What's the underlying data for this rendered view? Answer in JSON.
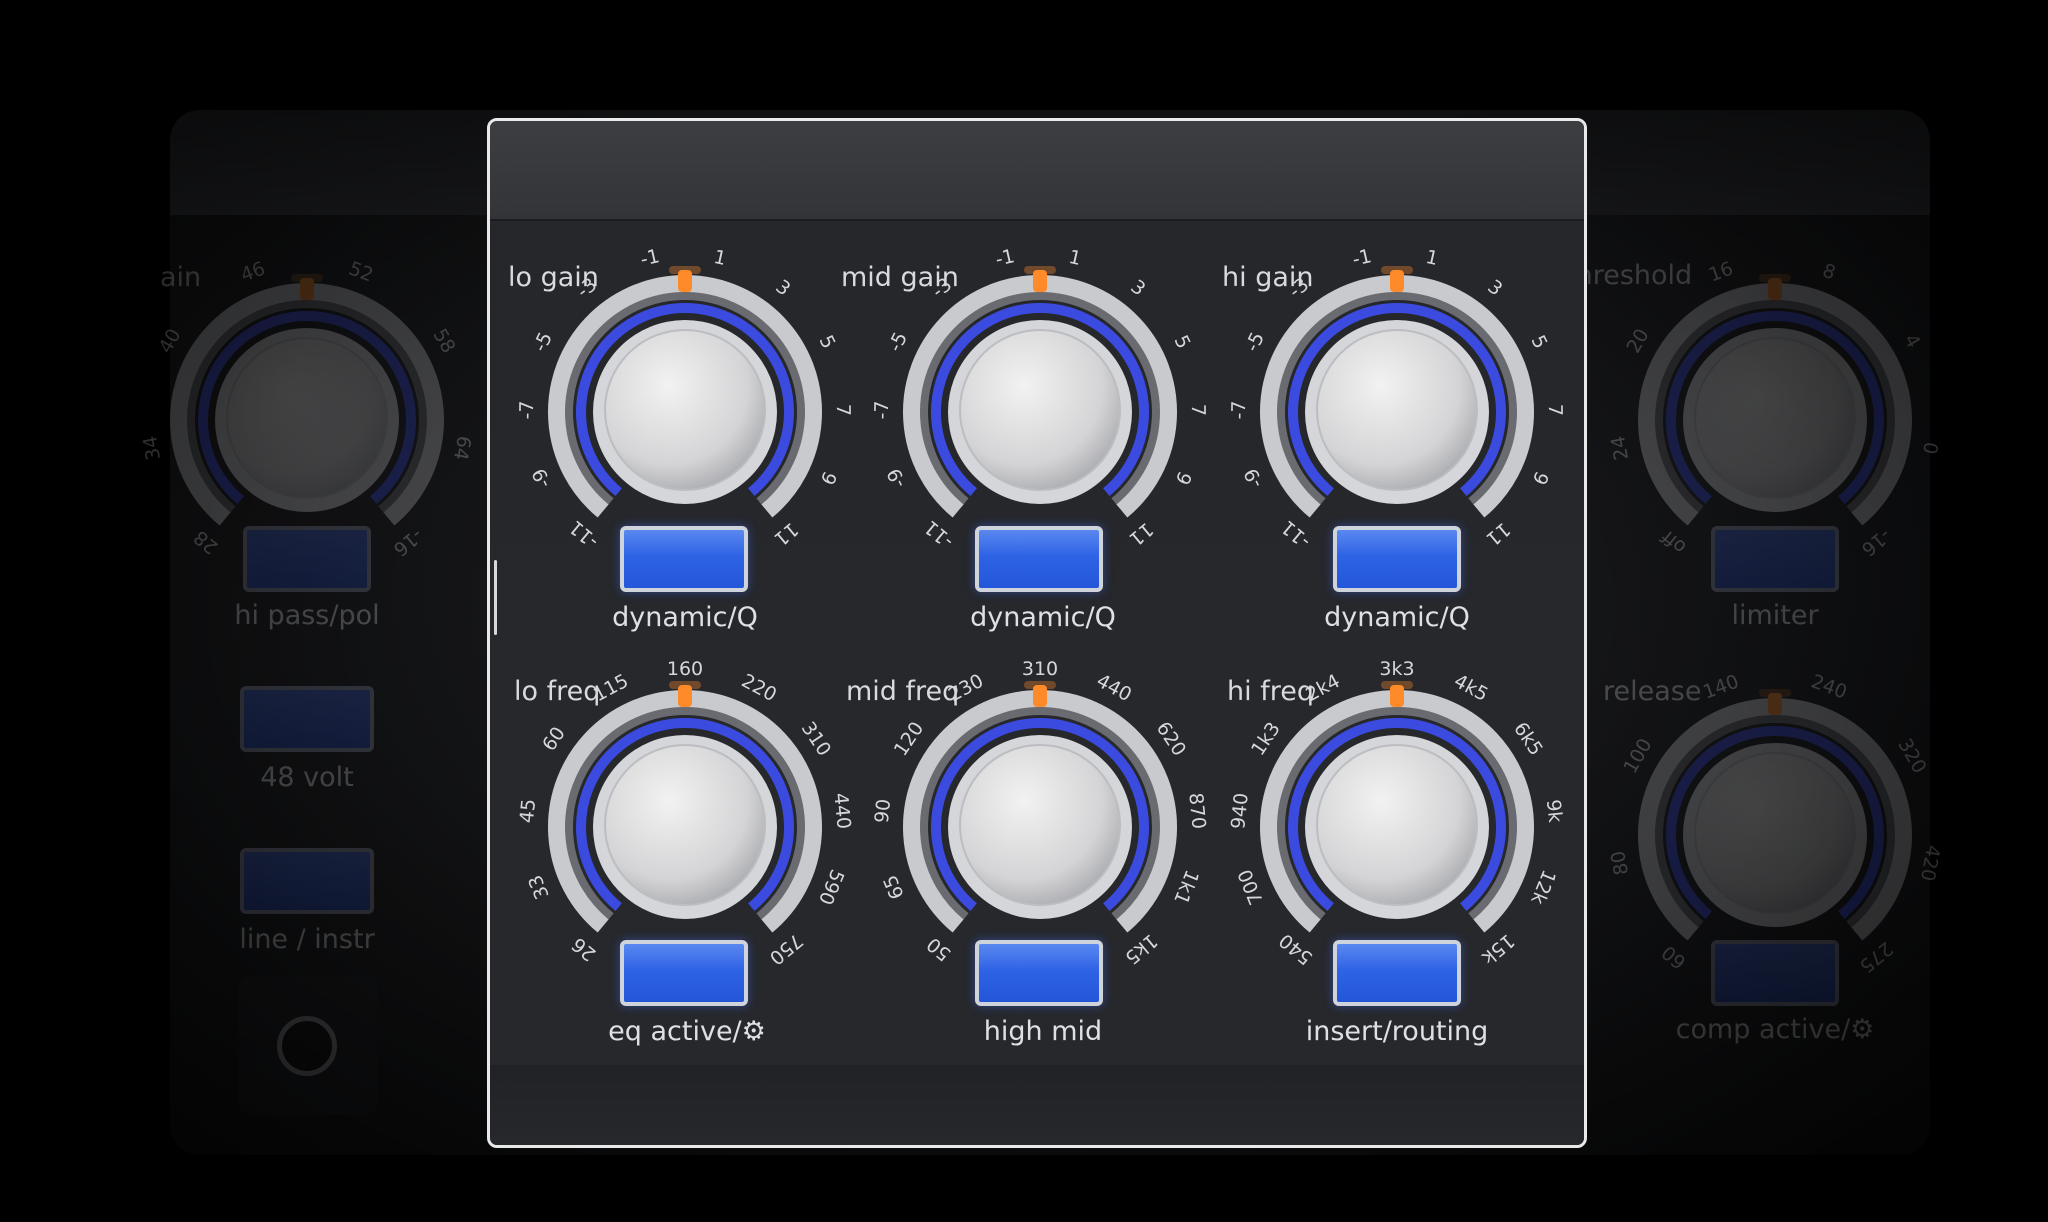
{
  "left_strip": {
    "gain": {
      "label": "ain",
      "ticks": [
        "28",
        "34",
        "40",
        "46",
        "52",
        "58",
        "64",
        "-16"
      ],
      "button_label": "hi pass/pol"
    },
    "phantom_button_label": "48 volt",
    "line_button_label": "line / instr"
  },
  "eq_panel": {
    "lo_gain": {
      "label": "lo gain",
      "ticks": [
        "-11",
        "-9",
        "-7",
        "-5",
        "-3",
        "-1",
        "1",
        "3",
        "5",
        "7",
        "9",
        "11"
      ],
      "button_label": "dynamic/Q"
    },
    "mid_gain": {
      "label": "mid gain",
      "ticks": [
        "-11",
        "-9",
        "-7",
        "-5",
        "-3",
        "-1",
        "1",
        "3",
        "5",
        "7",
        "9",
        "11"
      ],
      "button_label": "dynamic/Q"
    },
    "hi_gain": {
      "label": "hi gain",
      "ticks": [
        "-11",
        "-9",
        "-7",
        "-5",
        "-3",
        "-1",
        "1",
        "3",
        "5",
        "7",
        "9",
        "11"
      ],
      "button_label": "dynamic/Q"
    },
    "lo_freq": {
      "label": "lo freq",
      "ticks": [
        "26",
        "33",
        "45",
        "60",
        "115",
        "160",
        "220",
        "310",
        "440",
        "590",
        "750"
      ],
      "button_label": "eq active/⚙"
    },
    "mid_freq": {
      "label": "mid freq",
      "ticks": [
        "50",
        "65",
        "90",
        "120",
        "230",
        "310",
        "440",
        "620",
        "870",
        "1k1",
        "1k5"
      ],
      "button_label": "high mid"
    },
    "hi_freq": {
      "label": "hi freq",
      "ticks": [
        "540",
        "700",
        "940",
        "1k3",
        "2k4",
        "3k3",
        "4k5",
        "6k5",
        "9k",
        "12k",
        "15k"
      ],
      "button_label": "insert/routing"
    }
  },
  "right_strip": {
    "threshold": {
      "label": "threshold",
      "ticks": [
        "off",
        "24",
        "20",
        "16",
        "8",
        "4",
        "0",
        "-16"
      ],
      "button_label": "limiter"
    },
    "release": {
      "label": "release",
      "ticks": [
        "60",
        "80",
        "100",
        "140",
        "240",
        "320",
        "420",
        "275"
      ],
      "button_label": "comp active/⚙"
    }
  },
  "colors": {
    "ring_blue": "#3b4be0",
    "indicator_orange": "#ff8a2a",
    "button_blue": "#2f63e6",
    "panel_border": "#e9e9e9"
  }
}
